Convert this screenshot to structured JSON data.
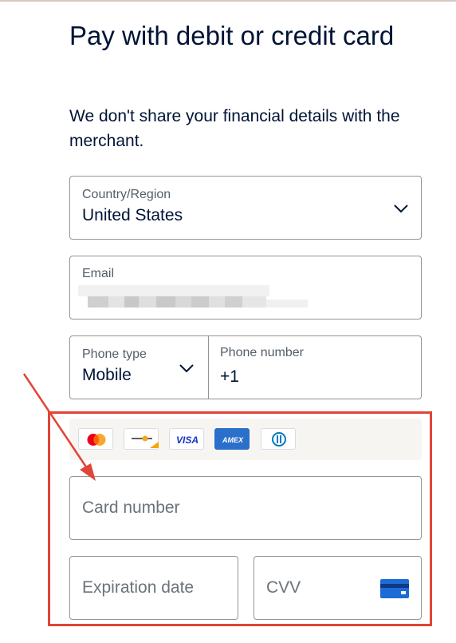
{
  "header": {
    "title": "Pay with debit or credit card",
    "subtitle": "We don't share your financial details with the merchant."
  },
  "form": {
    "country": {
      "label": "Country/Region",
      "value": "United States",
      "icon": "chevron-down-icon"
    },
    "email": {
      "label": "Email",
      "value_note": "blurred"
    },
    "phone_type": {
      "label": "Phone type",
      "value": "Mobile",
      "icon": "chevron-down-icon"
    },
    "phone_number": {
      "label": "Phone number",
      "value": "+1"
    },
    "card_brands": [
      "mastercard",
      "maestro",
      "visa",
      "amex",
      "diners"
    ],
    "card_brand_labels": {
      "visa": "VISA",
      "amex": "AMEX"
    },
    "card_number": {
      "placeholder": "Card number"
    },
    "expiration": {
      "placeholder": "Expiration date"
    },
    "cvv": {
      "placeholder": "CVV",
      "icon": "card-back-icon"
    }
  },
  "colors": {
    "text": "#001435",
    "label": "#545d68",
    "border": "#929496",
    "annotation": "#e0453a",
    "visa": "#1434cb",
    "amex": "#2a6fc9"
  }
}
